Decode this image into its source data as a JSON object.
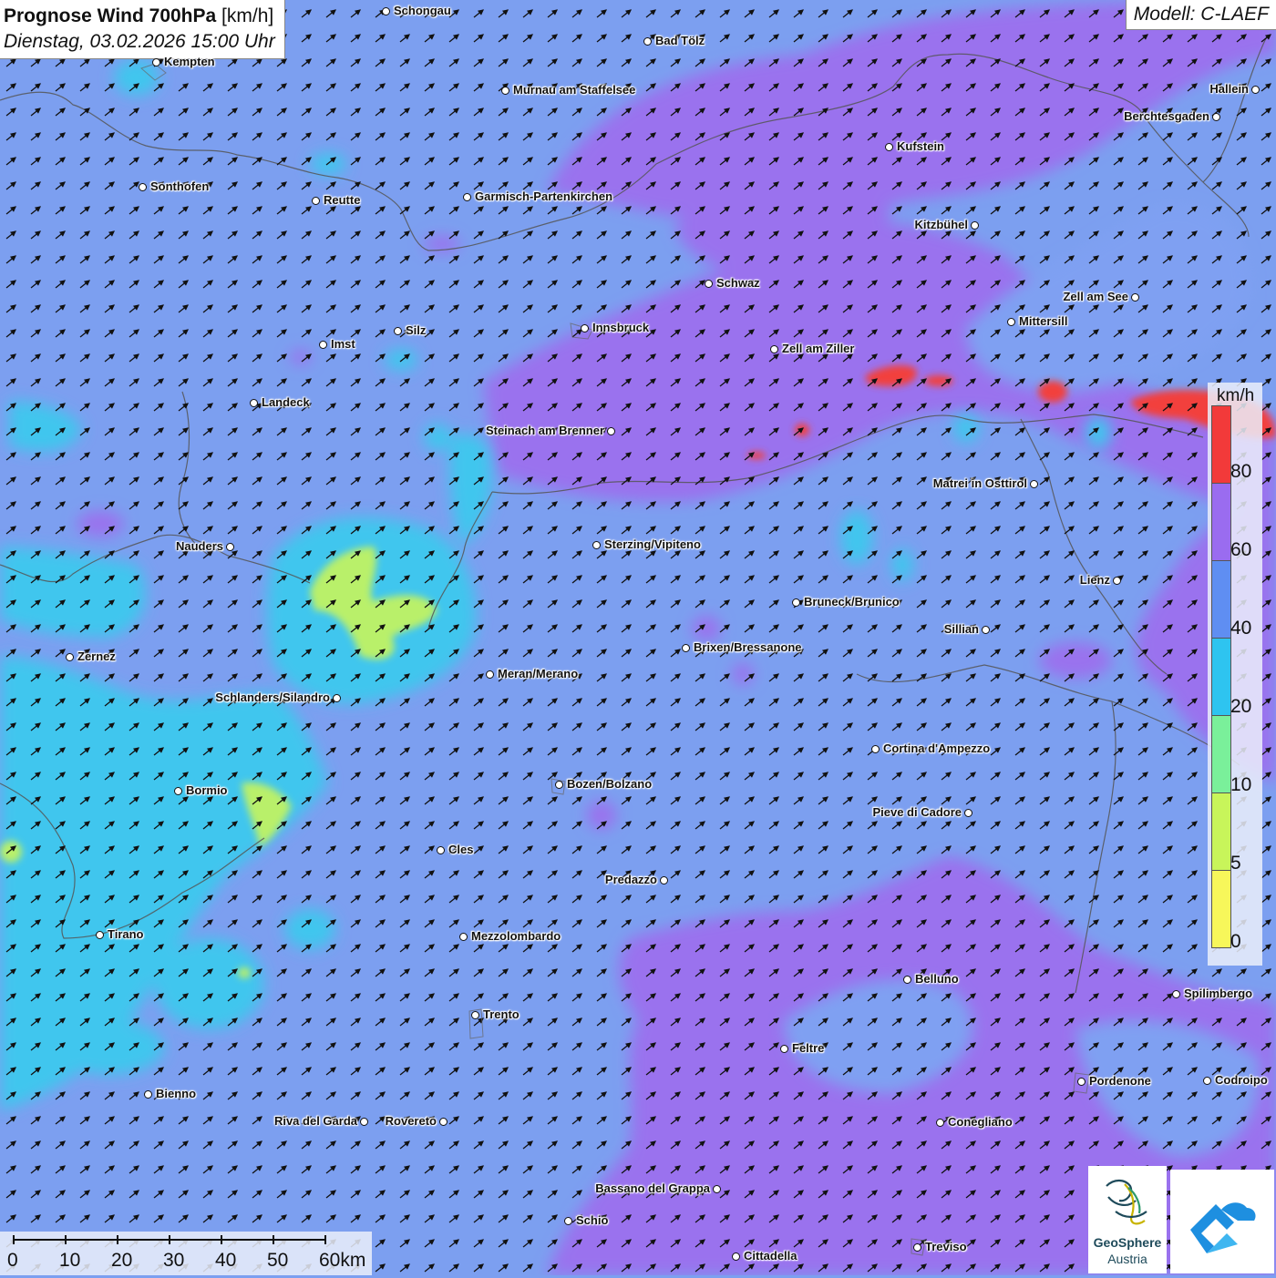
{
  "header": {
    "title_bold": "Prognose Wind 700hPa",
    "title_unit": "[km/h]",
    "datetime": "Dienstag, 03.02.2026 15:00 Uhr",
    "model": "Modell: C-LAEF"
  },
  "legend": {
    "unit": "km/h",
    "ticks": [
      "80",
      "60",
      "40",
      "20",
      "10",
      "5",
      "0"
    ],
    "colors": [
      "#f23a3a",
      "#9a6cf0",
      "#5f8ef2",
      "#2ec4f0",
      "#7af09a",
      "#c8f55a",
      "#f7f75a"
    ]
  },
  "scale": {
    "labels": [
      "0",
      "10",
      "20",
      "30",
      "40",
      "50",
      "60km"
    ]
  },
  "logo": {
    "name": "GeoSphere",
    "sub": "Austria"
  },
  "cities": [
    {
      "name": "Schongau"
    },
    {
      "name": "Bad Tölz"
    },
    {
      "name": "Kempten"
    },
    {
      "name": "Murnau am Staffelsee"
    },
    {
      "name": "Hallein"
    },
    {
      "name": "Berchtesgaden"
    },
    {
      "name": "Kufstein"
    },
    {
      "name": "Sonthofen"
    },
    {
      "name": "Reutte"
    },
    {
      "name": "Garmisch-Partenkirchen"
    },
    {
      "name": "Kitzbühel"
    },
    {
      "name": "Schwaz"
    },
    {
      "name": "Zell am See"
    },
    {
      "name": "Mittersill"
    },
    {
      "name": "Silz"
    },
    {
      "name": "Innsbruck"
    },
    {
      "name": "Imst"
    },
    {
      "name": "Zell am Ziller"
    },
    {
      "name": "Landeck"
    },
    {
      "name": "Steinach am Brenner"
    },
    {
      "name": "Matrei in Osttirol"
    },
    {
      "name": "Nauders"
    },
    {
      "name": "Sterzing/Vipiteno"
    },
    {
      "name": "Lienz"
    },
    {
      "name": "Bruneck/Brunico"
    },
    {
      "name": "Sillian"
    },
    {
      "name": "Brixen/Bressanone"
    },
    {
      "name": "Zernez"
    },
    {
      "name": "Meran/Merano"
    },
    {
      "name": "Schlanders/Silandro"
    },
    {
      "name": "Cortina d'Ampezzo"
    },
    {
      "name": "Bozen/Bolzano"
    },
    {
      "name": "Bormio"
    },
    {
      "name": "Pieve di Cadore"
    },
    {
      "name": "Cles"
    },
    {
      "name": "Predazzo"
    },
    {
      "name": "Tirano"
    },
    {
      "name": "Mezzolombardo"
    },
    {
      "name": "Belluno"
    },
    {
      "name": "Spilimbergo"
    },
    {
      "name": "Trento"
    },
    {
      "name": "Feltre"
    },
    {
      "name": "Pordenone"
    },
    {
      "name": "Codroipo"
    },
    {
      "name": "Bienno"
    },
    {
      "name": "Riva del Garda"
    },
    {
      "name": "Rovereto"
    },
    {
      "name": "Conegliano"
    },
    {
      "name": "Bassano del Grappa"
    },
    {
      "name": "Schio"
    },
    {
      "name": "Treviso"
    },
    {
      "name": "Cittadella"
    }
  ]
}
